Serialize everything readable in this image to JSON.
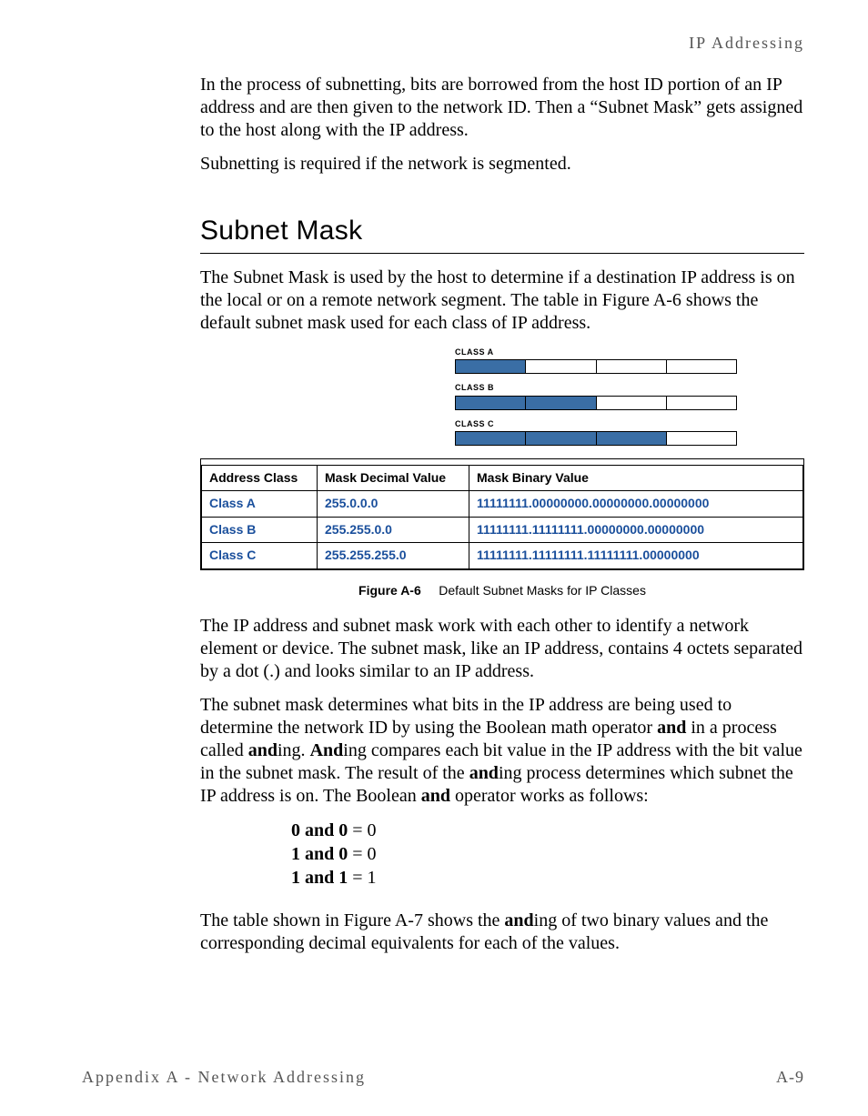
{
  "running_head": "IP Addressing",
  "intro": {
    "p1": "In the process of subnetting, bits are borrowed from the host ID portion of an IP address and are then given to the network ID. Then a “Subnet Mask” gets assigned to the host along with the IP address.",
    "p2": "Subnetting is required if the network is segmented."
  },
  "heading": "Subnet Mask",
  "body": {
    "p1": "The Subnet Mask is used by the host to determine if a destination IP address is on the local or on a remote network segment. The table in Figure A-6 shows the default subnet mask used for each class of IP address.",
    "p2": "The IP address and subnet mask work with each other to identify a network element or device. The subnet mask, like an IP address, contains 4 octets separated by a dot (.) and looks similar to an IP address.",
    "p3_pre": "The subnet mask determines what bits in the IP address are being used to determine the network ID by using the Boolean math operator ",
    "and": "and",
    "p3_mid1": " in a process called ",
    "p3_ing1": "ing. ",
    "And_cap": "And",
    "p3_mid2": "ing compares each bit value in the IP address with the bit value in the subnet mask. The result of the ",
    "p3_mid3": "ing process determines which subnet the IP address is on. The Boolean ",
    "p3_tail": " operator works as follows:",
    "p4_pre": "The table shown in Figure A-7 shows the ",
    "p4_post": "ing of two binary values and the corresponding decimal equivalents for each of the values."
  },
  "diagram": {
    "labels": {
      "A": "CLASS A",
      "B": "CLASS B",
      "C": "CLASS C"
    },
    "fill": {
      "A": 1,
      "B": 2,
      "C": 3
    }
  },
  "table": {
    "headers": {
      "c1": "Address Class",
      "c2": "Mask Decimal Value",
      "c3": "Mask Binary Value"
    },
    "rows": [
      {
        "c1": "Class A",
        "c2": "255.0.0.0",
        "c3": "11111111.00000000.00000000.00000000"
      },
      {
        "c1": "Class B",
        "c2": "255.255.0.0",
        "c3": "11111111.11111111.00000000.00000000"
      },
      {
        "c1": "Class C",
        "c2": "255.255.255.0",
        "c3": "11111111.11111111.11111111.00000000"
      }
    ]
  },
  "figure_caption": {
    "label": "Figure A-6",
    "text": "Default Subnet Masks for IP Classes"
  },
  "bool": {
    "l1_a": "0 and 0",
    "l1_b": " = 0",
    "l2_a": "1 and 0",
    "l2_b": " = 0",
    "l3_a": "1 and 1",
    "l3_b": " = 1"
  },
  "footer": {
    "left": "Appendix A - Network Addressing",
    "right": "A-9"
  }
}
